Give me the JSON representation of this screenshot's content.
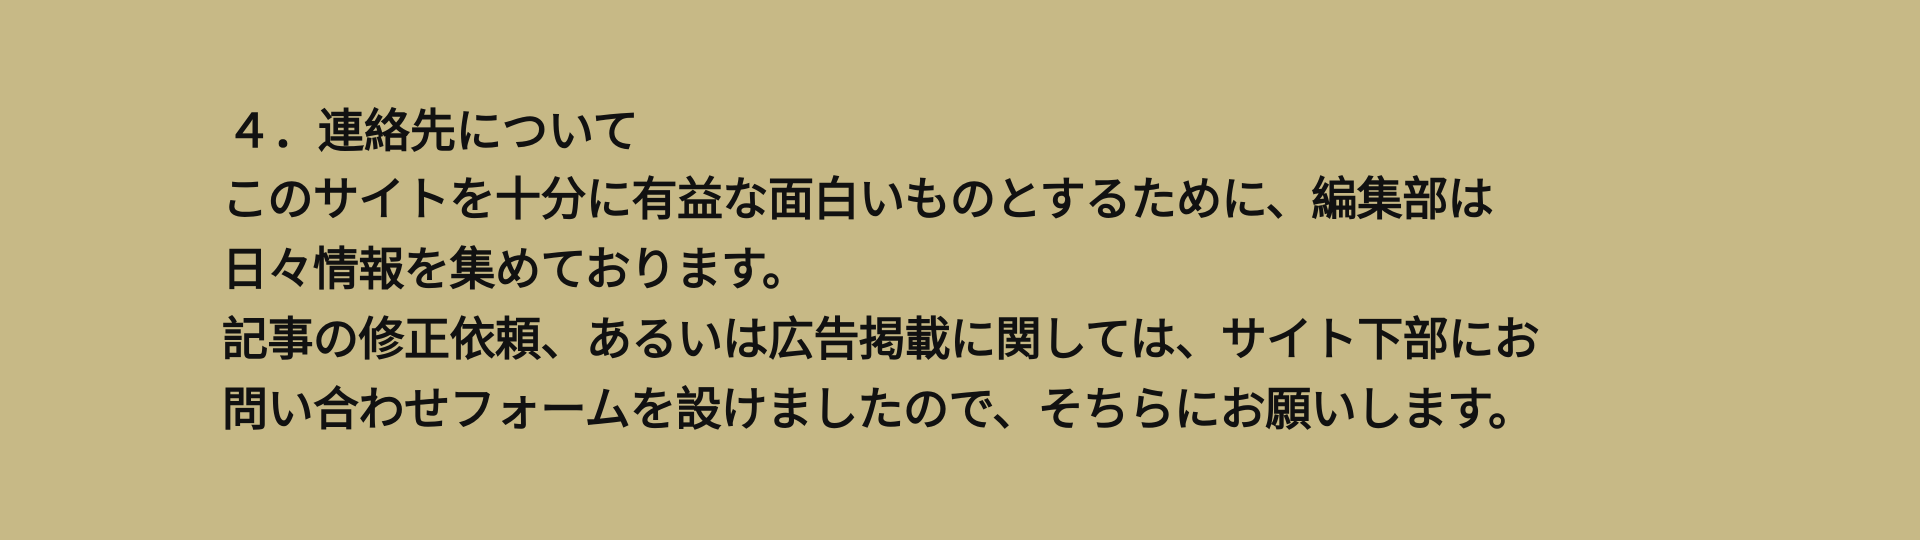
{
  "section": {
    "heading": "４．連絡先について",
    "lines": [
      "このサイトを十分に有益な面白いものとするために、編集部は",
      "日々情報を集めております。",
      "記事の修正依頼、あるいは広告掲載に関しては、サイト下部にお",
      "問い合わせフォームを設けましたので、そちらにお願いします。"
    ]
  }
}
